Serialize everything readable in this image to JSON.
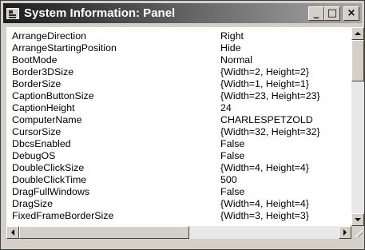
{
  "window": {
    "title": "System Information: Panel",
    "buttons": {
      "minimize": "_",
      "maximize": "□",
      "close": "×"
    }
  },
  "properties": [
    {
      "name": "ArrangeDirection",
      "value": "Right"
    },
    {
      "name": "ArrangeStartingPosition",
      "value": "Hide"
    },
    {
      "name": "BootMode",
      "value": "Normal"
    },
    {
      "name": "Border3DSize",
      "value": "{Width=2,  Height=2}"
    },
    {
      "name": "BorderSize",
      "value": "{Width=1,  Height=1}"
    },
    {
      "name": "CaptionButtonSize",
      "value": "{Width=23,  Height=23}"
    },
    {
      "name": "CaptionHeight",
      "value": "24"
    },
    {
      "name": "ComputerName",
      "value": "CHARLESPETZOLD"
    },
    {
      "name": "CursorSize",
      "value": "{Width=32,  Height=32}"
    },
    {
      "name": "DbcsEnabled",
      "value": "False"
    },
    {
      "name": "DebugOS",
      "value": "False"
    },
    {
      "name": "DoubleClickSize",
      "value": "{Width=4,  Height=4}"
    },
    {
      "name": "DoubleClickTime",
      "value": "500"
    },
    {
      "name": "DragFullWindows",
      "value": "False"
    },
    {
      "name": "DragSize",
      "value": "{Width=4,  Height=4}"
    },
    {
      "name": "FixedFrameBorderSize",
      "value": "{Width=3,  Height=3}"
    }
  ],
  "scroll": {
    "vertical_position": 0,
    "horizontal_position": 0
  }
}
